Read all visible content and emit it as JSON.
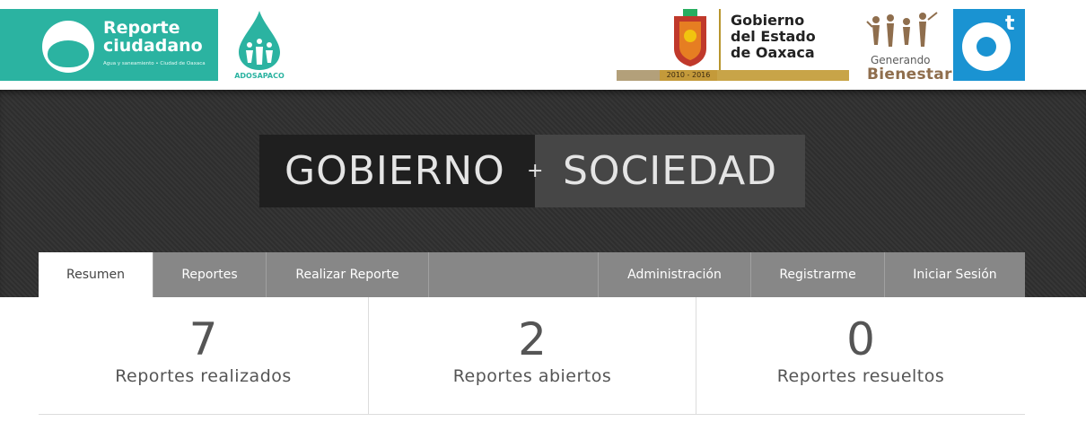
{
  "header": {
    "reporte_logo": {
      "line1": "Reporte",
      "line2": "ciudadano",
      "tagline": "Agua y saneamiento • Ciudad de Oaxaca"
    },
    "adosapaco_logo": {
      "label": "ADOSAPACO"
    },
    "gobierno_logo": {
      "line1": "Gobierno",
      "line2": "del Estado",
      "line3": "de Oaxaca",
      "years": "2010 - 2016"
    },
    "generando_logo": {
      "line1": "Generando",
      "line2": "Bienestar"
    },
    "ot_logo": {
      "mark": "t"
    }
  },
  "hero": {
    "left": "GOBIERNO",
    "plus": "+",
    "right": "SOCIEDAD"
  },
  "nav": {
    "tabs": [
      {
        "label": "Resumen",
        "active": true
      },
      {
        "label": "Reportes"
      },
      {
        "label": "Realizar Reporte"
      },
      {
        "label": ""
      },
      {
        "label": "Administración"
      },
      {
        "label": "Registrarme"
      },
      {
        "label": "Iniciar Sesión"
      }
    ]
  },
  "stats": [
    {
      "value": "7",
      "label": "Reportes realizados"
    },
    {
      "value": "2",
      "label": "Reportes abiertos"
    },
    {
      "value": "0",
      "label": "Reportes resueltos"
    }
  ],
  "colors": {
    "teal": "#2bb3a1",
    "ot_blue": "#1a93d2",
    "gold": "#c8a448",
    "hero_dark": "#2f2f2f",
    "nav_gray": "#878787"
  }
}
